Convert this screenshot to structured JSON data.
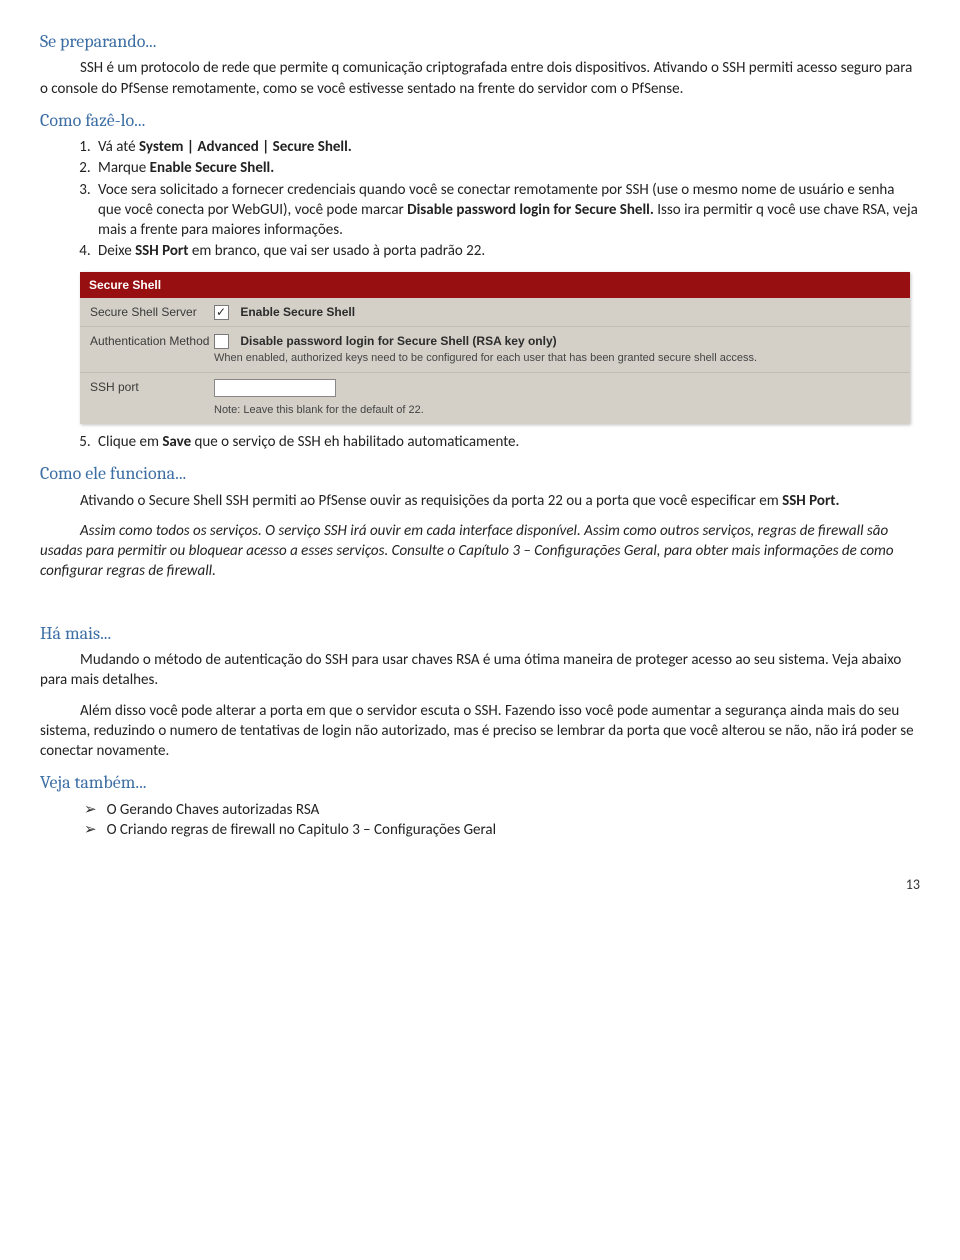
{
  "sePreparando": {
    "heading": "Se preparando...",
    "para": "SSH é um protocolo de rede que permite q comunicação criptografada entre dois dispositivos. Ativando o SSH permiti acesso seguro para o console do PfSense remotamente, como se você estivesse sentado na frente do servidor com o PfSense."
  },
  "comoFazeLo": {
    "heading": "Como fazê-lo...",
    "steps": {
      "s1_pre": "Vá até ",
      "s1_bold": "System | Advanced | Secure Shell.",
      "s2_pre": "Marque ",
      "s2_bold": "Enable Secure Shell.",
      "s3_a": "Voce sera solicitado a fornecer credenciais quando você se conectar remotamente por SSH (use o mesmo nome de usuário e senha que você conecta por WebGUI), você pode marcar ",
      "s3_bold": "Disable password login for Secure Shell.",
      "s3_b": " Isso ira permitir q você use chave RSA, veja mais a frente para maiores informações.",
      "s4_pre": "Deixe ",
      "s4_bold": "SSH Port",
      "s4_post": " em branco, que vai ser usado à porta padrão 22.",
      "s5_pre": "Clique em ",
      "s5_bold": "Save",
      "s5_post": " que o serviço de SSH eh habilitado automaticamente."
    }
  },
  "screenshot": {
    "title": "Secure Shell",
    "row1_label": "Secure Shell Server",
    "row1_text": "Enable Secure Shell",
    "row2_label": "Authentication Method",
    "row2_text": "Disable password login for Secure Shell (RSA key only)",
    "row2_hint": "When enabled, authorized keys need to be configured for each user that has been granted secure shell access.",
    "row3_label": "SSH port",
    "row3_hint": "Note: Leave this blank for the default of 22."
  },
  "comoFunciona": {
    "heading": "Como ele funciona...",
    "para1_pre": "Ativando o Secure Shell SSH permiti ao PfSense ouvir as requisições da porta 22 ou a porta que você especificar em ",
    "para1_bold": "SSH Port.",
    "para2": "Assim como todos os serviços. O serviço SSH irá ouvir em cada interface disponível. Assim como outros serviços, regras de firewall são usadas para permitir ou bloquear acesso a esses serviços. Consulte o Capítulo 3 – Configurações Geral, para obter mais informações de como configurar regras de firewall."
  },
  "haMais": {
    "heading": "Há mais...",
    "para1": "Mudando o método de autenticação do SSH para usar chaves RSA é uma ótima maneira de proteger acesso ao seu sistema. Veja abaixo para mais detalhes.",
    "para2": "Além disso você pode alterar a porta em que o servidor escuta o SSH. Fazendo isso você pode aumentar a segurança ainda mais do seu sistema, reduzindo o numero de tentativas de login não autorizado, mas é preciso se lembrar da porta que você alterou se não, não irá poder se conectar novamente."
  },
  "vejaTambem": {
    "heading": "Veja também...",
    "li1": "O Gerando Chaves autorizadas RSA",
    "li2": "O Criando regras de firewall no Capitulo 3 – Configurações Geral"
  },
  "pageNumber": "13"
}
